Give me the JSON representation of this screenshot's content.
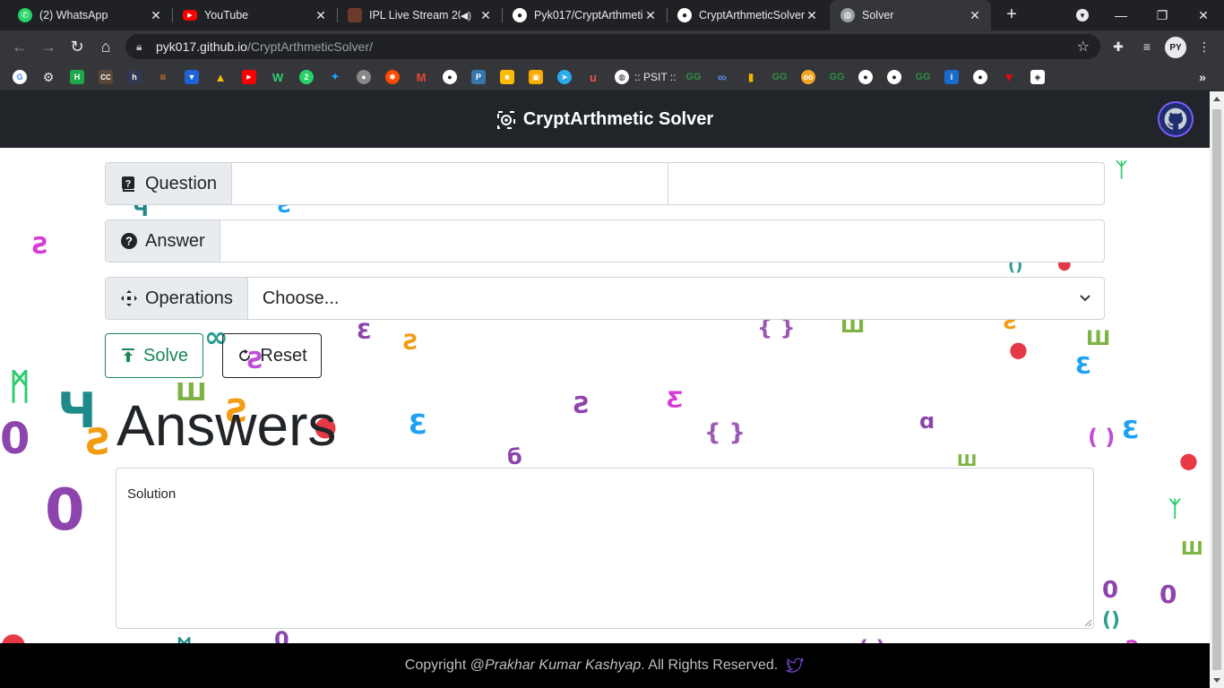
{
  "browser": {
    "tabs": [
      {
        "title": "(2) WhatsApp",
        "icon": "whatsapp-icon",
        "color": "#25d366"
      },
      {
        "title": "YouTube",
        "icon": "youtube-icon",
        "color": "#ff0000"
      },
      {
        "title": "IPL Live Stream 20",
        "icon": "ipl-icon",
        "color": "#6b3a2a"
      },
      {
        "title": "Pyk017/CryptArthmeti",
        "icon": "github-icon",
        "color": "#ffffff"
      },
      {
        "title": "CryptArthmeticSolver/",
        "icon": "github-icon",
        "color": "#ffffff"
      },
      {
        "title": "Solver",
        "icon": "globe-icon",
        "color": "#9aa0a6"
      }
    ],
    "url_host": "pyk017.github.io",
    "url_path": "/CryptArthmeticSolver/",
    "profile_initials": "PY",
    "bookmarks_psit": ":: PSIT ::"
  },
  "app": {
    "title": "CryptArthmetic Solver",
    "question_label": "Question",
    "answer_label": "Answer",
    "operations_label": "Operations",
    "operations_selected": "Choose...",
    "solve_label": "Solve",
    "reset_label": "Reset",
    "answers_heading": "Answers",
    "solution_placeholder": "Solution",
    "footer_prefix": "Copyright @",
    "footer_author": "Prakhar Kumar Kashyap",
    "footer_suffix": ". All Rights Reserved.",
    "accent_success": "#198754",
    "navbar_bg": "#212529"
  }
}
